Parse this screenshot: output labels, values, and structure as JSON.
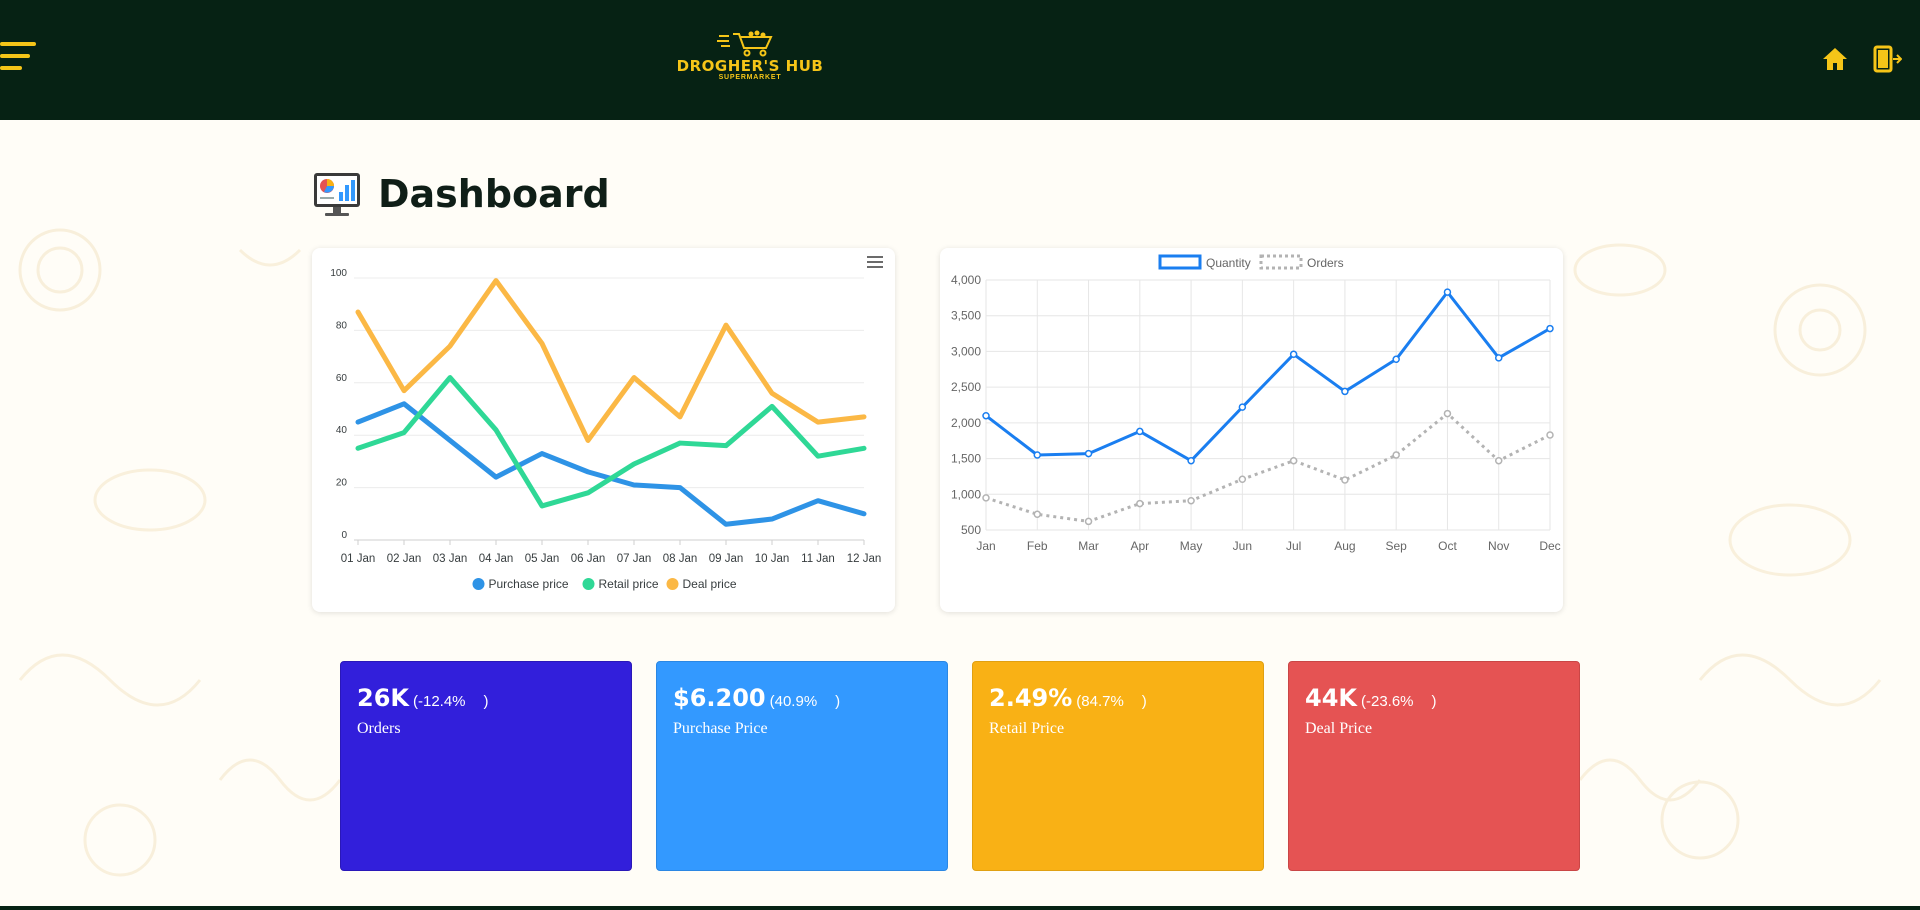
{
  "header": {
    "brand": "DROGHER'S HUB",
    "brand_sub": "SUPERMARKET",
    "icons": [
      "hamburger-menu-icon",
      "home-icon",
      "logout-icon"
    ],
    "accent_color": "#f5c518",
    "bg_color": "#062214"
  },
  "page": {
    "title": "Dashboard",
    "title_icon": "dashboard-monitor-icon"
  },
  "chart_data": [
    {
      "type": "line",
      "x": [
        "01 Jan",
        "02 Jan",
        "03 Jan",
        "04 Jan",
        "05 Jan",
        "06 Jan",
        "07 Jan",
        "08 Jan",
        "09 Jan",
        "10 Jan",
        "11 Jan",
        "12 Jan"
      ],
      "y_ticks": [
        0,
        20,
        40,
        60,
        80,
        100
      ],
      "ylim": [
        0,
        100
      ],
      "grid": "horizontal",
      "legend_position": "bottom",
      "series": [
        {
          "name": "Purchase price",
          "color": "#2e93e6",
          "values": [
            45,
            52,
            38,
            24,
            33,
            26,
            21,
            20,
            6,
            8,
            15,
            10
          ]
        },
        {
          "name": "Retail price",
          "color": "#2fd896",
          "values": [
            35,
            41,
            62,
            42,
            13,
            18,
            29,
            37,
            36,
            51,
            32,
            35
          ]
        },
        {
          "name": "Deal price",
          "color": "#fbb845",
          "values": [
            87,
            57,
            74,
            99,
            75,
            38,
            62,
            47,
            82,
            56,
            45,
            47
          ]
        }
      ]
    },
    {
      "type": "line",
      "x": [
        "Jan",
        "Feb",
        "Mar",
        "Apr",
        "May",
        "Jun",
        "Jul",
        "Aug",
        "Sep",
        "Oct",
        "Nov",
        "Dec"
      ],
      "y_ticks": [
        "500",
        "1,000",
        "1,500",
        "2,000",
        "2,500",
        "3,000",
        "3,500",
        "4,000"
      ],
      "ylim": [
        500,
        4000
      ],
      "grid": "both",
      "legend_position": "top",
      "series": [
        {
          "name": "Quantity",
          "color": "#1a7ef0",
          "style": "solid",
          "values": [
            2100,
            1550,
            1570,
            1880,
            1470,
            2220,
            2960,
            2440,
            2890,
            3830,
            2910,
            3320
          ]
        },
        {
          "name": "Orders",
          "color": "#b3b3b3",
          "style": "dotted",
          "values": [
            950,
            720,
            620,
            870,
            910,
            1210,
            1470,
            1200,
            1550,
            2130,
            1470,
            1830
          ]
        }
      ]
    }
  ],
  "stats": [
    {
      "value": "26K",
      "change": "(-12.4%",
      "close": ")",
      "label": "Orders",
      "color": "#321fdb"
    },
    {
      "value": "$6.200",
      "change": "(40.9%",
      "close": ")",
      "label": "Purchase Price",
      "color": "#3399ff"
    },
    {
      "value": "2.49%",
      "change": "(84.7%",
      "close": ")",
      "label": "Retail Price",
      "color": "#f9b115"
    },
    {
      "value": "44K",
      "change": "(-23.6%",
      "close": ")",
      "label": "Deal Price",
      "color": "#e55353"
    }
  ]
}
